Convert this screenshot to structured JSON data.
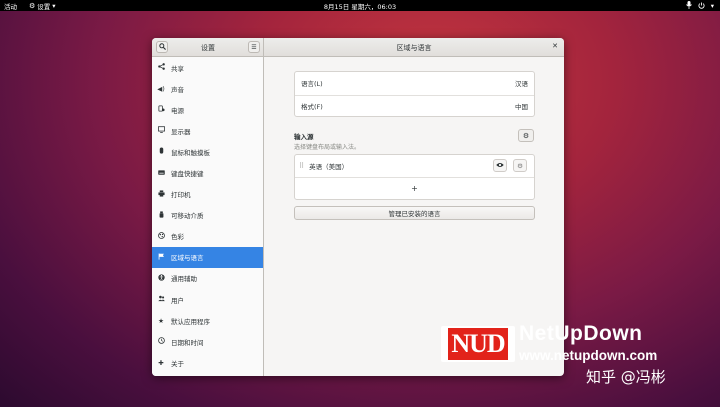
{
  "topbar": {
    "activities": "活动",
    "app_menu": "设置",
    "clock": "8月15日 星期六，06:03"
  },
  "window": {
    "sidebar_title": "设置",
    "main_title": "区域与语言"
  },
  "sidebar": {
    "items": [
      {
        "label": "共享",
        "icon": "share-icon"
      },
      {
        "label": "声音",
        "icon": "speaker-icon"
      },
      {
        "label": "电源",
        "icon": "power-icon"
      },
      {
        "label": "显示器",
        "icon": "display-icon"
      },
      {
        "label": "鼠标和触摸板",
        "icon": "mouse-icon"
      },
      {
        "label": "键盘快捷键",
        "icon": "keyboard-icon"
      },
      {
        "label": "打印机",
        "icon": "printer-icon"
      },
      {
        "label": "可移动介质",
        "icon": "usb-icon"
      },
      {
        "label": "色彩",
        "icon": "palette-icon"
      },
      {
        "label": "区域与语言",
        "icon": "flag-icon"
      },
      {
        "label": "通用辅助",
        "icon": "accessibility-icon"
      },
      {
        "label": "用户",
        "icon": "users-icon"
      },
      {
        "label": "默认应用程序",
        "icon": "star-icon"
      },
      {
        "label": "日期和时间",
        "icon": "clock-icon"
      },
      {
        "label": "关于",
        "icon": "plus-icon"
      }
    ],
    "active_index": 9
  },
  "main": {
    "language_label": "语言(L)",
    "language_value": "汉语",
    "format_label": "格式(F)",
    "format_value": "中国",
    "input_sources_title": "输入源",
    "input_sources_hint": "选择键盘布局或输入法。",
    "input_source_item": "英语（美国）",
    "add_symbol": "+",
    "manage_button": "管理已安装的语言"
  },
  "watermark": {
    "logo_text": "NUD",
    "brand": "NetUpDown",
    "url": "www.netupdown.com",
    "zhihu": "知乎 @冯彬"
  },
  "colors": {
    "accent": "#3584e4",
    "topbar": "#000000",
    "window_bg": "#f6f5f4",
    "logo_red": "#e2231a"
  }
}
